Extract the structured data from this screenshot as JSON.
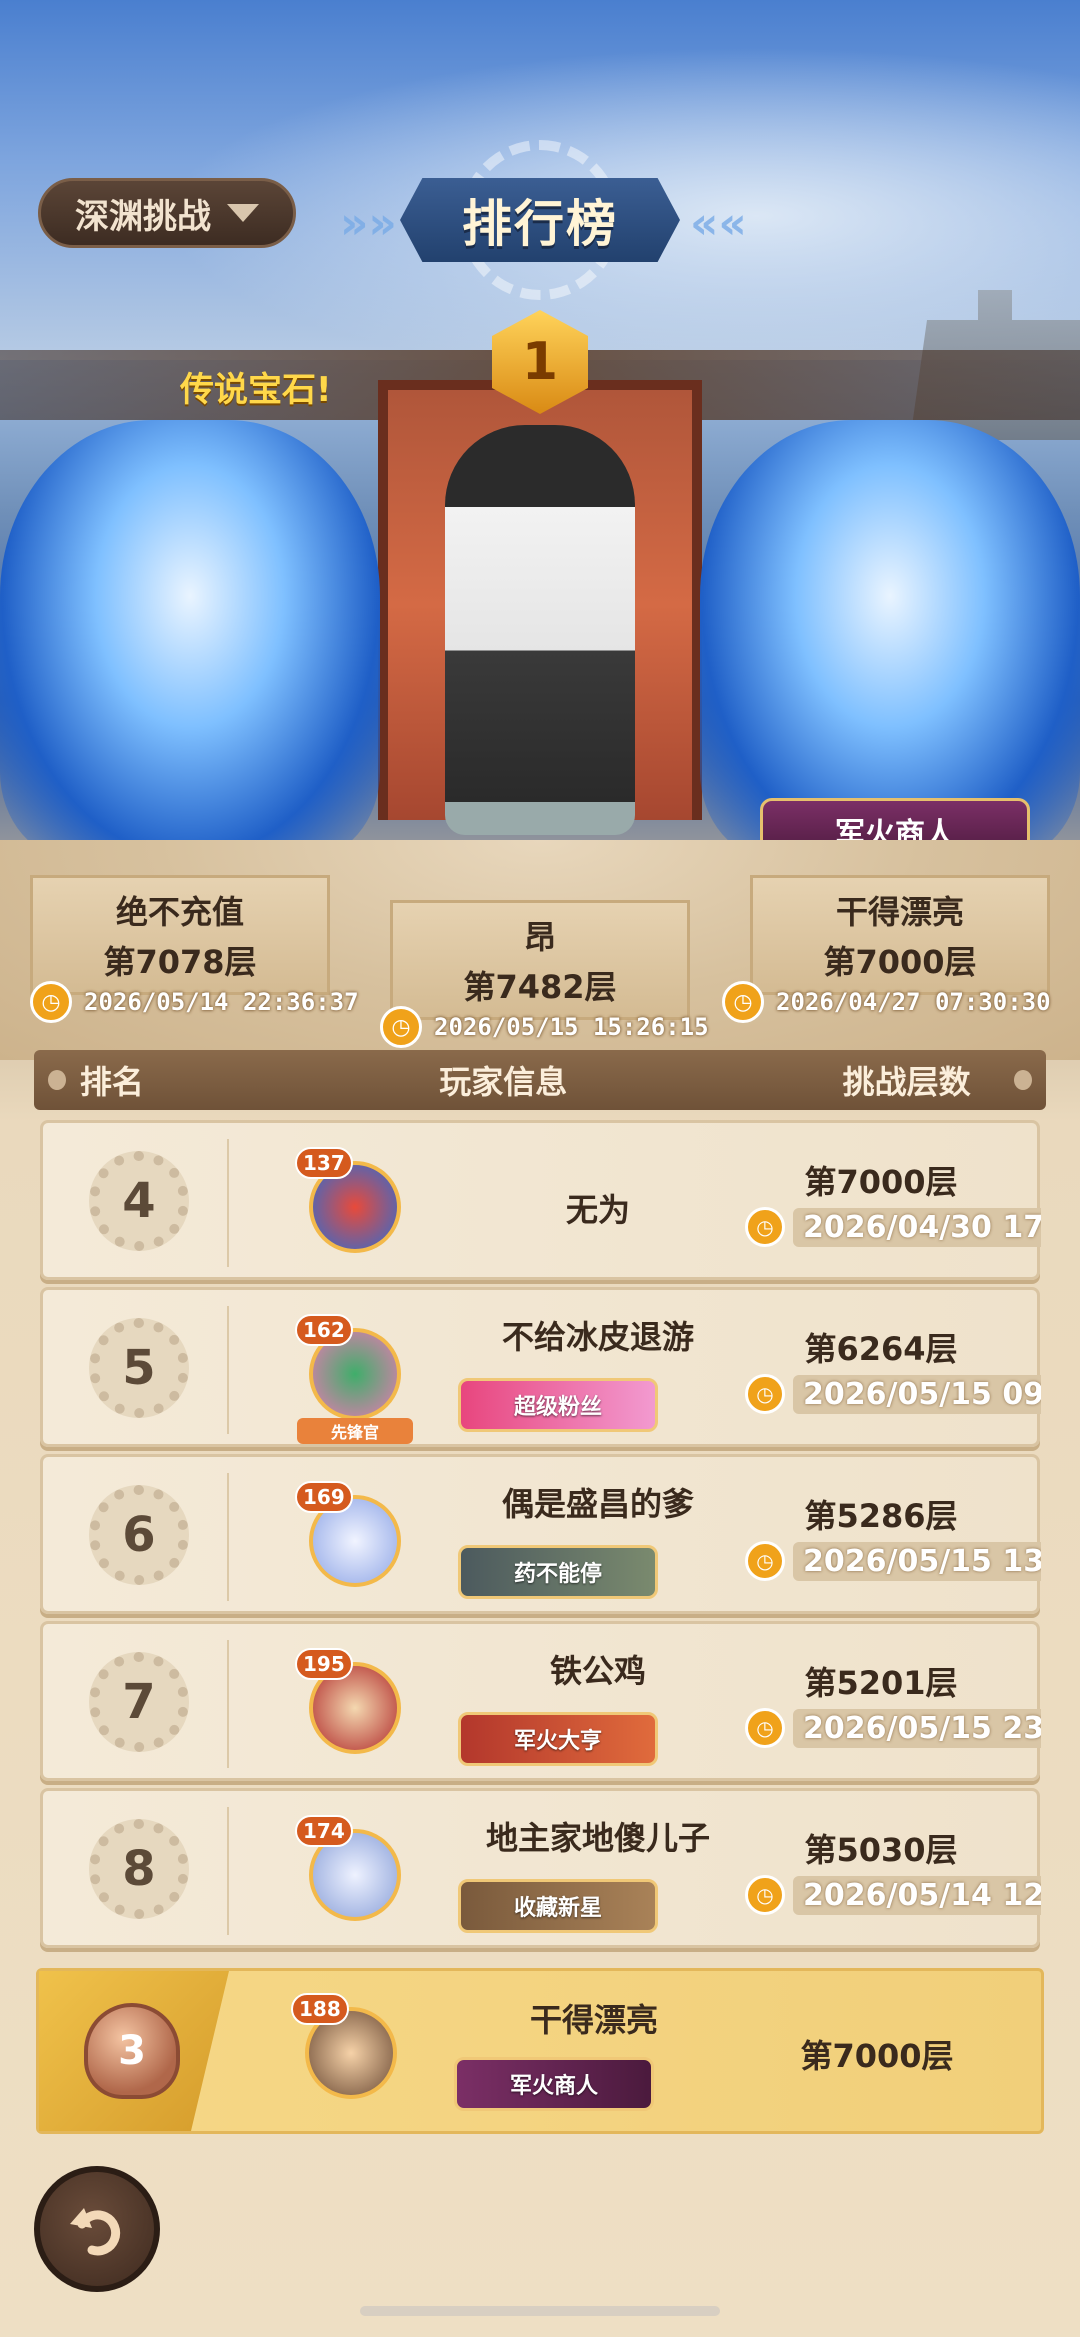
{
  "header": {
    "mode_label": "深渊挑战",
    "title": "排行榜"
  },
  "podium": {
    "banner_text": "传说宝石!",
    "crown_rank": "1",
    "title_tag": "军火商人",
    "left": {
      "name": "绝不充值",
      "floor": "第7078层",
      "time": "2026/05/14 22:36:37"
    },
    "mid": {
      "name": "昂",
      "floor": "第7482层",
      "time": "2026/05/15 15:26:15"
    },
    "right": {
      "name": "干得漂亮",
      "floor": "第7000层",
      "time": "2026/04/27 07:30:30"
    }
  },
  "table": {
    "headers": {
      "rank": "排名",
      "player": "玩家信息",
      "floor": "挑战层数"
    },
    "rows": [
      {
        "rank": "4",
        "level": "137",
        "name": "无为",
        "badge": "",
        "floor": "第7000层",
        "time": "2026/04/30 17"
      },
      {
        "rank": "5",
        "level": "162",
        "role": "先锋官",
        "name": "不给冰皮退游",
        "badge": "超级粉丝",
        "floor": "第6264层",
        "time": "2026/05/15 09"
      },
      {
        "rank": "6",
        "level": "169",
        "name": "偶是盛昌的爹",
        "badge": "药不能停",
        "floor": "第5286层",
        "time": "2026/05/15 13"
      },
      {
        "rank": "7",
        "level": "195",
        "name": "铁公鸡",
        "badge": "军火大亨",
        "floor": "第5201层",
        "time": "2026/05/15 23"
      },
      {
        "rank": "8",
        "level": "174",
        "name": "地主家地傻儿子",
        "badge": "收藏新星",
        "floor": "第5030层",
        "time": "2026/05/14 12"
      }
    ]
  },
  "self": {
    "rank": "3",
    "level": "188",
    "name": "干得漂亮",
    "badge": "军火商人",
    "floor": "第7000层"
  },
  "colors": {
    "accent_gold": "#f0a21a",
    "banner_blue": "#22416e",
    "row_bg": "#f4ead8"
  }
}
